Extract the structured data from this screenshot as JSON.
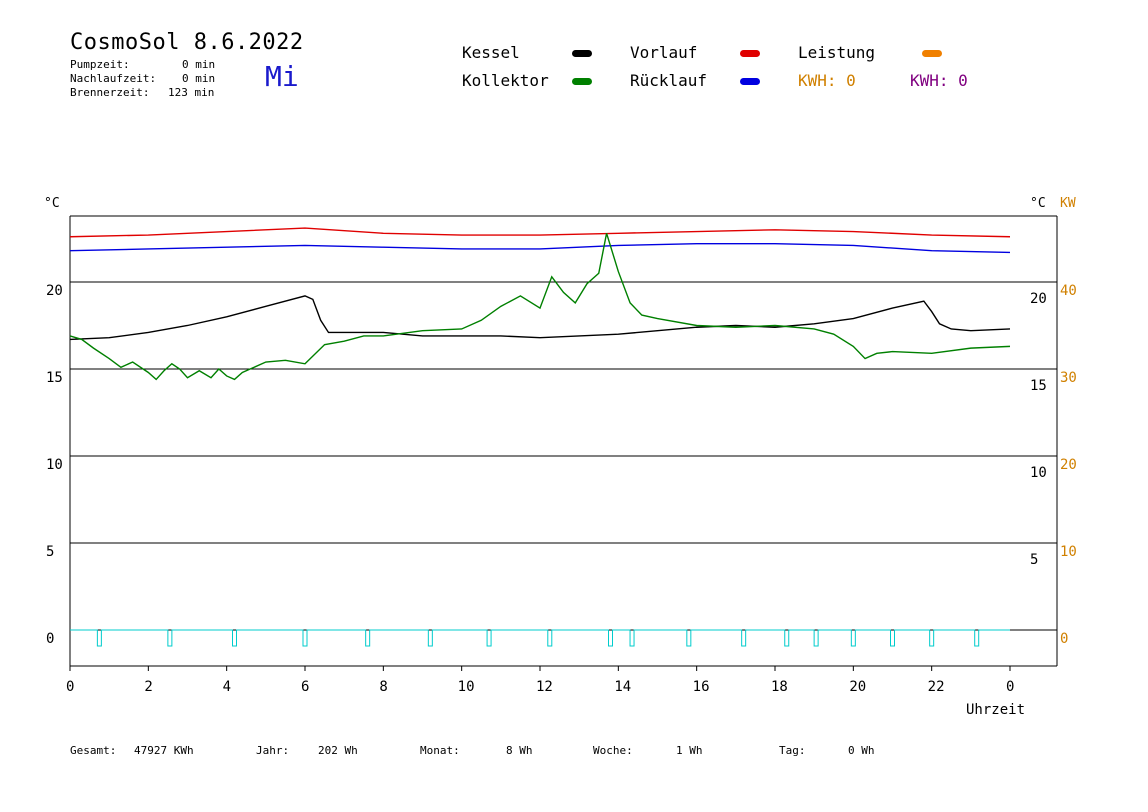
{
  "header": {
    "title": "CosmoSol 8.6.2022",
    "weekday": "Mi",
    "stats": [
      {
        "label": "Pumpzeit:",
        "value": "0 min"
      },
      {
        "label": "Nachlaufzeit:",
        "value": "0 min"
      },
      {
        "label": "Brennerzeit:",
        "value": "123 min"
      }
    ]
  },
  "legend": {
    "kessel": {
      "label": "Kessel",
      "color": "#000000"
    },
    "kollektor": {
      "label": "Kollektor",
      "color": "#008000"
    },
    "vorlauf": {
      "label": "Vorlauf",
      "color": "#e00000"
    },
    "ruecklauf": {
      "label": "Rücklauf",
      "color": "#0000e0"
    },
    "leistung": {
      "label": "Leistung",
      "color": "#f08000"
    },
    "kwh1": {
      "label": "KWH: 0",
      "color": "#d08000"
    },
    "kwh2": {
      "label": "KWH: 0",
      "color": "#800080"
    }
  },
  "footer": {
    "gesamt_label": "Gesamt:",
    "gesamt_value": "47927 KWh",
    "jahr_label": "Jahr:",
    "jahr_value": "202 Wh",
    "monat_label": "Monat:",
    "monat_value": "8 Wh",
    "woche_label": "Woche:",
    "woche_value": "1 Wh",
    "tag_label": "Tag:",
    "tag_value": "0 Wh"
  },
  "chart_data": {
    "type": "line",
    "xlabel": "Uhrzeit",
    "ylabel_left": "°C",
    "ylabel_right_celsius": "°C",
    "ylabel_right_kw": "KW",
    "xlim": [
      0,
      24
    ],
    "ylim_left": [
      -2,
      24.5
    ],
    "x_tick_labels": [
      "0",
      "2",
      "4",
      "6",
      "8",
      "10",
      "12",
      "14",
      "16",
      "18",
      "20",
      "22",
      "0"
    ],
    "x_tick_values": [
      0,
      2,
      4,
      6,
      8,
      10,
      12,
      14,
      16,
      18,
      20,
      22,
      24
    ],
    "y_left_ticks": [
      0,
      5,
      10,
      15,
      20
    ],
    "y_right_celsius_ticks": [
      5,
      10,
      15,
      20
    ],
    "y_right_kw_ticks": [
      0,
      10,
      20,
      30,
      40
    ],
    "grid": "horizontal",
    "series": [
      {
        "name": "Vorlauf",
        "color": "#e00000",
        "x": [
          0,
          2,
          4,
          6,
          8,
          10,
          12,
          14,
          16,
          18,
          20,
          22,
          24
        ],
        "y": [
          22.6,
          22.7,
          22.9,
          23.1,
          22.8,
          22.7,
          22.7,
          22.8,
          22.9,
          23.0,
          22.9,
          22.7,
          22.6
        ]
      },
      {
        "name": "Rücklauf",
        "color": "#0000e0",
        "x": [
          0,
          2,
          4,
          6,
          8,
          10,
          12,
          14,
          16,
          18,
          20,
          22,
          24
        ],
        "y": [
          21.8,
          21.9,
          22.0,
          22.1,
          22.0,
          21.9,
          21.9,
          22.1,
          22.2,
          22.2,
          22.1,
          21.8,
          21.7
        ]
      },
      {
        "name": "Kessel",
        "color": "#000000",
        "x": [
          0,
          1,
          2,
          3,
          4,
          5,
          6,
          6.2,
          6.4,
          6.6,
          7,
          8,
          9,
          10,
          11,
          12,
          13,
          14,
          15,
          16,
          17,
          18,
          19,
          20,
          21,
          21.8,
          22,
          22.2,
          22.5,
          23,
          24
        ],
        "y": [
          16.7,
          16.8,
          17.1,
          17.5,
          18.0,
          18.6,
          19.2,
          19.0,
          17.8,
          17.1,
          17.1,
          17.1,
          16.9,
          16.9,
          16.9,
          16.8,
          16.9,
          17.0,
          17.2,
          17.4,
          17.5,
          17.4,
          17.6,
          17.9,
          18.5,
          18.9,
          18.3,
          17.6,
          17.3,
          17.2,
          17.3
        ]
      },
      {
        "name": "Kollektor",
        "color": "#008000",
        "x": [
          0,
          0.3,
          0.6,
          1,
          1.3,
          1.6,
          2,
          2.2,
          2.4,
          2.6,
          2.8,
          3,
          3.3,
          3.6,
          3.8,
          4,
          4.2,
          4.4,
          4.6,
          5,
          5.5,
          6,
          6.5,
          7,
          7.5,
          8,
          9,
          10,
          10.5,
          11,
          11.5,
          12,
          12.3,
          12.6,
          12.9,
          13.2,
          13.5,
          13.7,
          14,
          14.3,
          14.6,
          15,
          16,
          17,
          18,
          19,
          19.5,
          20,
          20.3,
          20.6,
          21,
          22,
          23,
          24
        ],
        "y": [
          16.9,
          16.7,
          16.2,
          15.6,
          15.1,
          15.4,
          14.8,
          14.4,
          14.9,
          15.3,
          15.0,
          14.5,
          14.9,
          14.5,
          15.0,
          14.6,
          14.4,
          14.8,
          15.0,
          15.4,
          15.5,
          15.3,
          16.4,
          16.6,
          16.9,
          16.9,
          17.2,
          17.3,
          17.8,
          18.6,
          19.2,
          18.5,
          20.3,
          19.4,
          18.8,
          19.9,
          20.5,
          22.8,
          20.6,
          18.8,
          18.1,
          17.9,
          17.5,
          17.4,
          17.5,
          17.3,
          17.0,
          16.3,
          15.6,
          15.9,
          16.0,
          15.9,
          16.2,
          16.3
        ]
      },
      {
        "name": "Pumpe",
        "color": "#00cccc",
        "pulse_times": [
          0.75,
          2.55,
          4.2,
          6.0,
          7.6,
          9.2,
          10.7,
          12.25,
          13.8,
          14.35,
          15.8,
          17.2,
          18.3,
          19.05,
          20.0,
          21.0,
          22.0,
          23.15
        ]
      }
    ]
  }
}
